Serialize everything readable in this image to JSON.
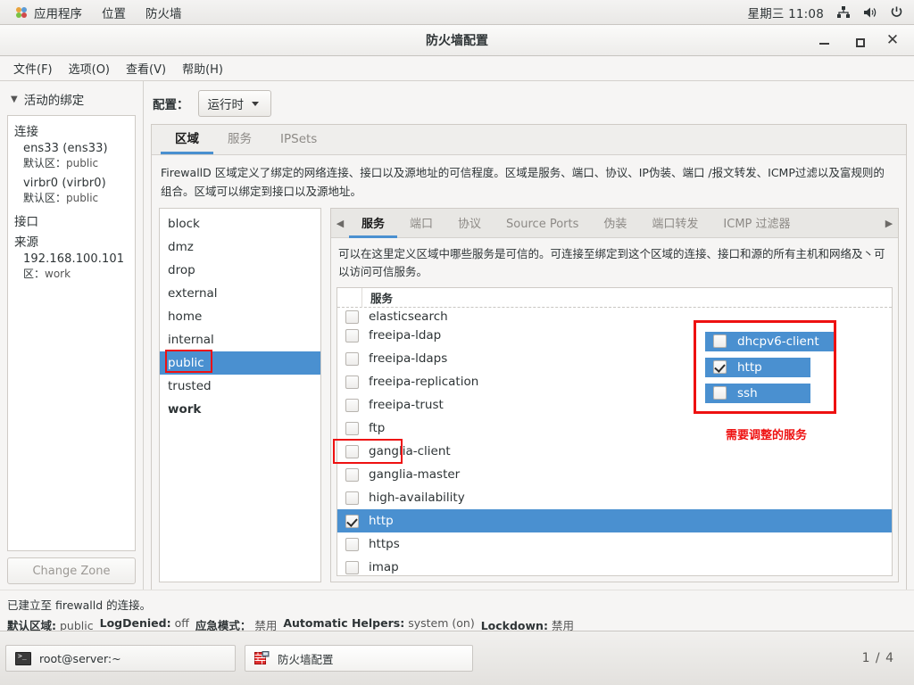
{
  "gnome_panel": {
    "items": [
      {
        "label": "应用程序",
        "icon": "applications-icon"
      },
      {
        "label": "位置",
        "icon": ""
      },
      {
        "label": "防火墙",
        "icon": ""
      }
    ],
    "clock": "星期三 11:08",
    "tray": [
      "network-icon",
      "volume-icon",
      "power-icon"
    ]
  },
  "window": {
    "title": "防火墙配置",
    "controls": {
      "minimize": "_",
      "maximize": "□",
      "close": "✕"
    },
    "menubar": [
      "文件(F)",
      "选项(O)",
      "查看(V)",
      "帮助(H)"
    ]
  },
  "sidebar": {
    "header": "活动的绑定",
    "groups": [
      {
        "title": "连接",
        "entries": [
          {
            "name": "ens33 (ens33)",
            "label": "默认区：",
            "value": "public"
          },
          {
            "name": "virbr0 (virbr0)",
            "label": "默认区：",
            "value": "public"
          }
        ]
      },
      {
        "title": "接口",
        "entries": []
      },
      {
        "title": "来源",
        "entries": [
          {
            "name": "192.168.100.101",
            "label": "区：",
            "value": "work"
          }
        ]
      }
    ],
    "change_zone_button": "Change Zone"
  },
  "main": {
    "config_label": "配置：",
    "config_value": "运行时",
    "tabs": [
      {
        "label": "区域",
        "active": true
      },
      {
        "label": "服务",
        "active": false
      },
      {
        "label": "IPSets",
        "active": false
      }
    ],
    "description": "FirewallD 区域定义了绑定的网络连接、接口以及源地址的可信程度。区域是服务、端口、协议、IP伪装、端口 /报文转发、ICMP过滤以及富规则的组合。区域可以绑定到接口以及源地址。",
    "zones": [
      {
        "name": "block",
        "selected": false,
        "bold": false
      },
      {
        "name": "dmz",
        "selected": false,
        "bold": false
      },
      {
        "name": "drop",
        "selected": false,
        "bold": false
      },
      {
        "name": "external",
        "selected": false,
        "bold": false
      },
      {
        "name": "home",
        "selected": false,
        "bold": false
      },
      {
        "name": "internal",
        "selected": false,
        "bold": false
      },
      {
        "name": "public",
        "selected": true,
        "bold": false
      },
      {
        "name": "trusted",
        "selected": false,
        "bold": false
      },
      {
        "name": "work",
        "selected": false,
        "bold": true
      }
    ],
    "subtabs": [
      {
        "label": "服务",
        "active": true
      },
      {
        "label": "端口",
        "active": false
      },
      {
        "label": "协议",
        "active": false
      },
      {
        "label": "Source Ports",
        "active": false
      },
      {
        "label": "伪装",
        "active": false
      },
      {
        "label": "端口转发",
        "active": false
      },
      {
        "label": "ICMP 过滤器",
        "active": false
      }
    ],
    "subtab_scroll_left": "◀",
    "subtab_scroll_right": "▶",
    "subdescription": "可以在这里定义区域中哪些服务是可信的。可连接至绑定到这个区域的连接、接口和源的所有主机和网络及丶可以访问可信服务。",
    "service_table_header": "服务",
    "services": [
      {
        "name": "elasticsearch",
        "checked": false,
        "selected": false
      },
      {
        "name": "freeipa-ldap",
        "checked": false,
        "selected": false
      },
      {
        "name": "freeipa-ldaps",
        "checked": false,
        "selected": false
      },
      {
        "name": "freeipa-replication",
        "checked": false,
        "selected": false
      },
      {
        "name": "freeipa-trust",
        "checked": false,
        "selected": false
      },
      {
        "name": "ftp",
        "checked": false,
        "selected": false
      },
      {
        "name": "ganglia-client",
        "checked": false,
        "selected": false
      },
      {
        "name": "ganglia-master",
        "checked": false,
        "selected": false
      },
      {
        "name": "high-availability",
        "checked": false,
        "selected": false
      },
      {
        "name": "http",
        "checked": true,
        "selected": true
      },
      {
        "name": "https",
        "checked": false,
        "selected": false
      },
      {
        "name": "imap",
        "checked": false,
        "selected": false
      }
    ]
  },
  "annotation": {
    "caption": "需要调整的服务",
    "color": "#ee1111",
    "items": [
      {
        "name": "dhcpv6-client",
        "checked": false
      },
      {
        "name": "http",
        "checked": true
      },
      {
        "name": "ssh",
        "checked": false
      }
    ]
  },
  "statusbar": {
    "connection_message": "已建立至 firewalld 的连接。",
    "fields": [
      {
        "key": "默认区域:",
        "value": "public"
      },
      {
        "key": "LogDenied:",
        "value": "off"
      },
      {
        "key": "应急模式：",
        "value": "禁用"
      },
      {
        "key": "Automatic Helpers:",
        "value": "system (on)"
      },
      {
        "key": "Lockdown:",
        "value": "禁用"
      }
    ]
  },
  "taskbar": {
    "buttons": [
      {
        "label": "root@server:~",
        "icon": "terminal-icon"
      },
      {
        "label": "防火墙配置",
        "icon": "firewall-icon"
      }
    ],
    "pager": "1 / 4"
  },
  "colors": {
    "selection_blue": "#4a90d0",
    "annotation_red": "#ee1111",
    "panel_bg": "#f6f5f4"
  }
}
